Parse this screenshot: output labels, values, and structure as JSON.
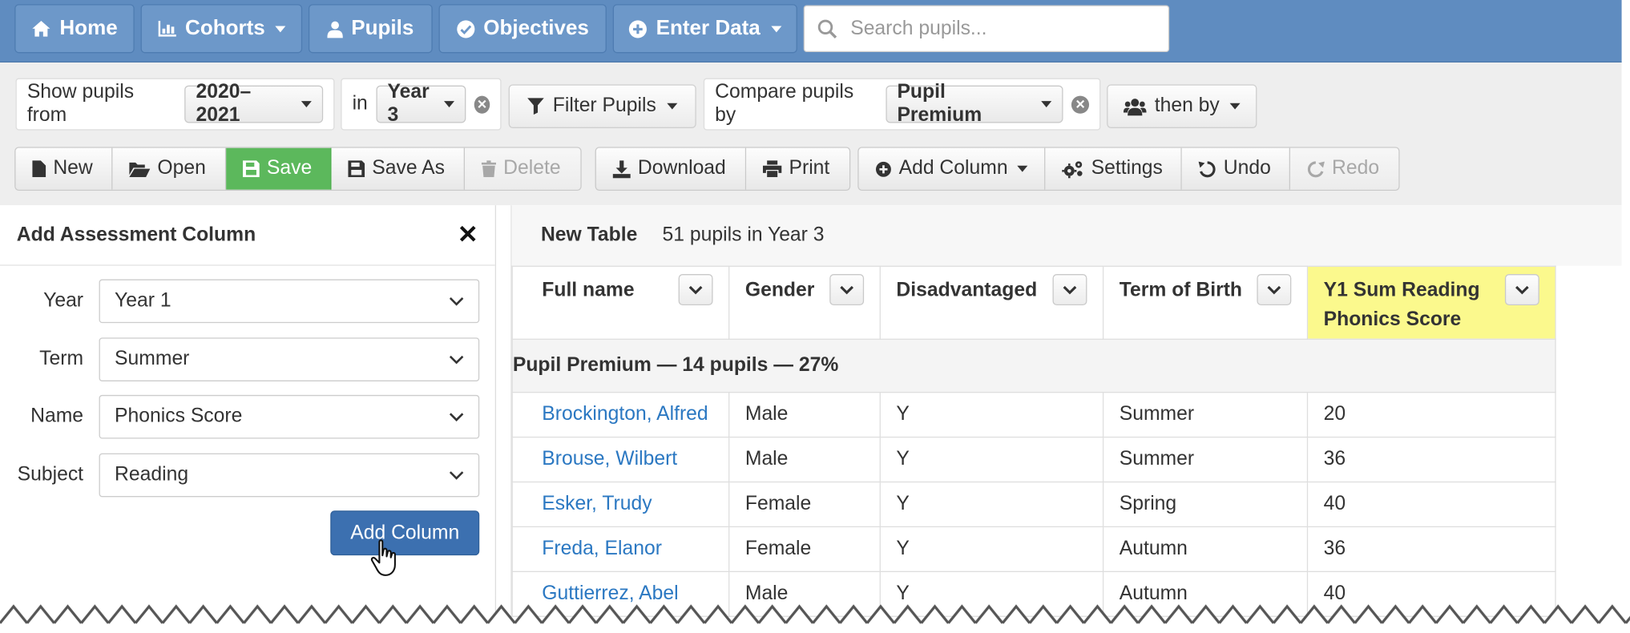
{
  "nav": {
    "items": [
      {
        "label": "Home",
        "icon": "home-icon"
      },
      {
        "label": "Cohorts",
        "icon": "bar-chart-icon",
        "dropdown": true
      },
      {
        "label": "Pupils",
        "icon": "user-icon"
      },
      {
        "label": "Objectives",
        "icon": "check-circle-icon"
      },
      {
        "label": "Enter Data",
        "icon": "plus-circle-icon",
        "dropdown": true
      }
    ],
    "search_placeholder": "Search pupils..."
  },
  "filters": {
    "show_from_label": "Show pupils from",
    "year_value": "2020–2021",
    "in_label": "in",
    "class_value": "Year 3",
    "filter_button": "Filter Pupils",
    "compare_label": "Compare pupils by",
    "compare_value": "Pupil Premium",
    "then_by_button": "then by"
  },
  "toolbar": {
    "new": "New",
    "open": "Open",
    "save": "Save",
    "save_as": "Save As",
    "delete": "Delete",
    "download": "Download",
    "print": "Print",
    "add_column": "Add Column",
    "settings": "Settings",
    "undo": "Undo",
    "redo": "Redo"
  },
  "sidebar": {
    "title": "Add Assessment Column",
    "fields": {
      "year": {
        "label": "Year",
        "value": "Year 1"
      },
      "term": {
        "label": "Term",
        "value": "Summer"
      },
      "name": {
        "label": "Name",
        "value": "Phonics Score"
      },
      "subject": {
        "label": "Subject",
        "value": "Reading"
      }
    },
    "submit": "Add Column"
  },
  "table": {
    "name": "New Table",
    "summary": "51 pupils in Year 3",
    "columns": {
      "full_name": "Full name",
      "gender": "Gender",
      "disadvantaged": "Disadvantaged",
      "term_of_birth": "Term of Birth",
      "score_line1": "Y1 Sum Reading",
      "score_line2": "Phonics Score"
    },
    "group_label": "Pupil Premium — 14 pupils — 27%",
    "rows": [
      {
        "name": "Brockington, Alfred",
        "gender": "Male",
        "disadvantaged": "Y",
        "term": "Summer",
        "score": "20",
        "score_color": "#e02020"
      },
      {
        "name": "Brouse, Wilbert",
        "gender": "Male",
        "disadvantaged": "Y",
        "term": "Summer",
        "score": "36",
        "score_color": "#6aa84f"
      },
      {
        "name": "Esker, Trudy",
        "gender": "Female",
        "disadvantaged": "Y",
        "term": "Spring",
        "score": "40",
        "score_color": "#6aa84f"
      },
      {
        "name": "Freda, Elanor",
        "gender": "Female",
        "disadvantaged": "Y",
        "term": "Autumn",
        "score": "36",
        "score_color": "#6aa84f"
      },
      {
        "name": "Guttierrez, Abel",
        "gender": "Male",
        "disadvantaged": "Y",
        "term": "Autumn",
        "score": "40",
        "score_color": "#6aa84f"
      }
    ]
  },
  "colors": {
    "navbar": "#5f8cc0",
    "save_green": "#5cb85c",
    "primary_blue": "#3c70b0",
    "highlight_yellow": "#fbf98d",
    "link_blue": "#2b78c2"
  }
}
